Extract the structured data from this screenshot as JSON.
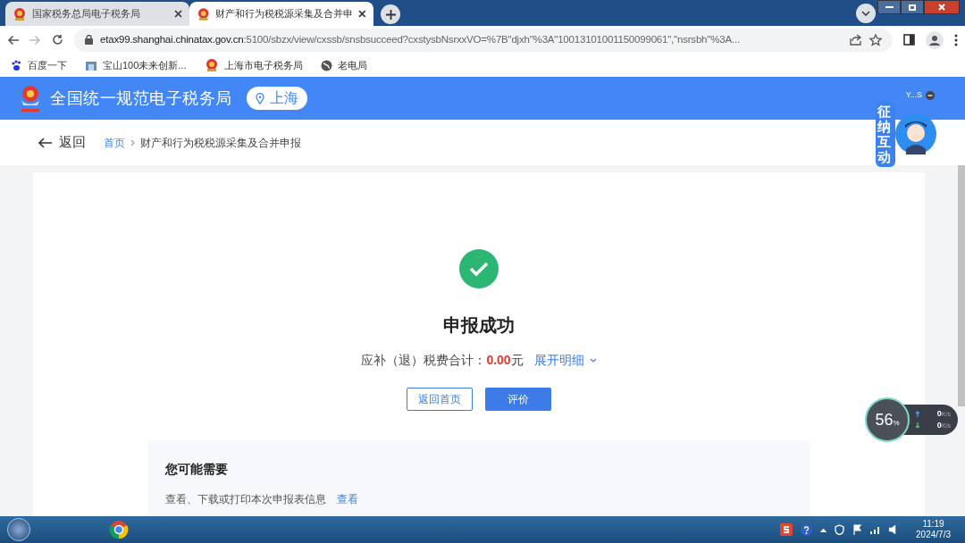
{
  "browser": {
    "tabs": [
      {
        "title": "国家税务总局电子税务局",
        "selected": false
      },
      {
        "title": "财产和行为税税源采集及合并申",
        "selected": true
      }
    ],
    "url": {
      "host": "etax99.shanghai.chinatax.gov.cn",
      "path": ":5100/sbzx/view/cxssb/snsbsucceed?cxstysbNsrxxVO=%7B\"djxh\"%3A\"10013101001150099061\",\"nsrsbh\"%3A..."
    },
    "bookmarks": [
      "百度一下",
      "宝山100未来创新...",
      "上海市电子税务局",
      "老电局"
    ]
  },
  "header": {
    "title": "全国统一规范电子税务局",
    "region": "上海"
  },
  "nav": {
    "back": "返回",
    "breadcrumb": [
      "首页",
      "财产和行为税税源采集及合并申报"
    ]
  },
  "result": {
    "title": "申报成功",
    "total_label": "应补（退）税费合计：",
    "amount": "0.00",
    "unit": "元",
    "details_link": "展开明细",
    "buttons": [
      "返回首页",
      "评价"
    ]
  },
  "suggest": {
    "title": "您可能需要",
    "text": "查看、下载或打印本次申报表信息",
    "link": "查看"
  },
  "assistant": {
    "user": "Y...S",
    "label": "征纳互动"
  },
  "speed_widget": {
    "percent": "56",
    "unit": "%",
    "upload": "0",
    "upload_unit": "K/s",
    "download": "0",
    "download_unit": "K/s"
  },
  "taskbar": {
    "time": "11:19",
    "date": "2024/7/3"
  }
}
